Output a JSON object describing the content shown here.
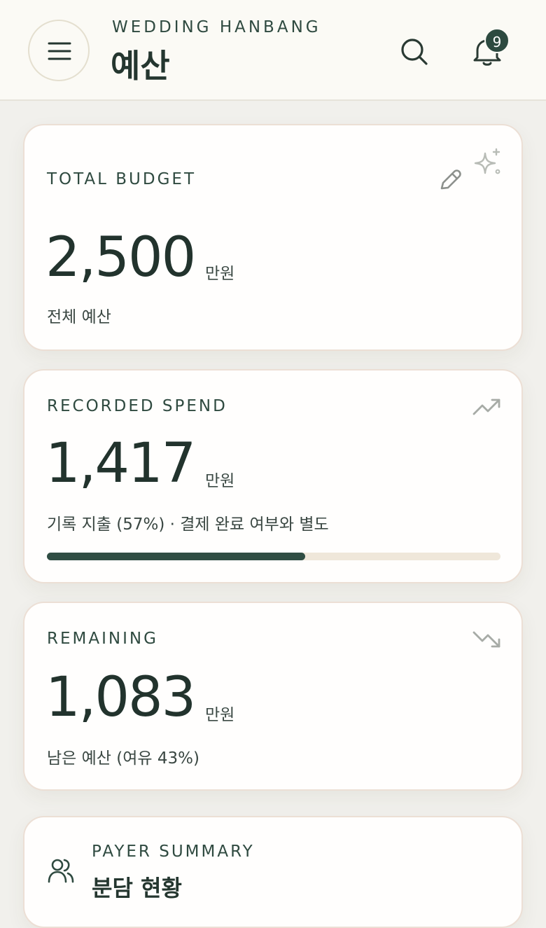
{
  "header": {
    "brand": "WEDDING HANBANG",
    "title": "예산",
    "notification_count": "9"
  },
  "total_budget": {
    "label": "TOTAL BUDGET",
    "amount": "2,500",
    "unit": "만원",
    "caption": "전체 예산"
  },
  "recorded_spend": {
    "label": "RECORDED SPEND",
    "amount": "1,417",
    "unit": "만원",
    "caption": "기록 지출 (57%) · 결제 완료 여부와 별도",
    "progress_percent": 57
  },
  "remaining": {
    "label": "REMAINING",
    "amount": "1,083",
    "unit": "만원",
    "caption": "남은 예산 (여유 43%)"
  },
  "payer_summary": {
    "label": "PAYER SUMMARY",
    "title": "분담 현황"
  },
  "colors": {
    "accent": "#2f4d43",
    "track": "#efe7da",
    "background": "#f1f0ec"
  }
}
